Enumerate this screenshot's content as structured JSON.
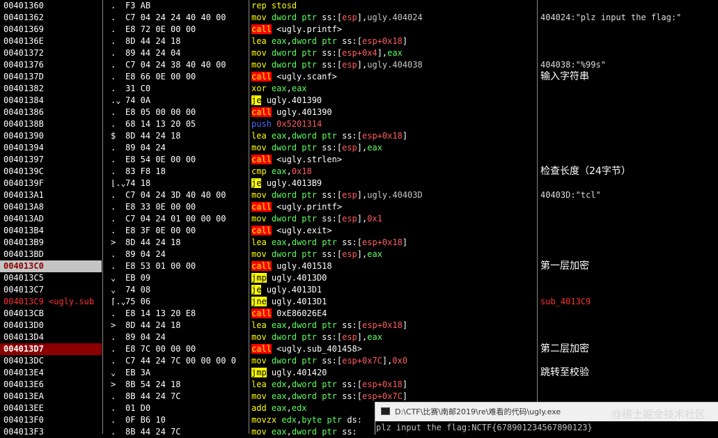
{
  "rows": [
    {
      "addr": "00401360",
      "mark": ".",
      "bytes": "F3 AB",
      "mn": "rep",
      "mt": "plain",
      "ops": [
        {
          "t": "stosd",
          "c": "mnc"
        }
      ],
      "comment": ""
    },
    {
      "addr": "00401362",
      "mark": ".",
      "bytes": "C7 04 24 24 40 40 00",
      "mn": "mov",
      "mt": "plain",
      "ops": [
        {
          "t": "dword ptr ",
          "c": "kw"
        },
        {
          "t": "ss:",
          "c": ""
        },
        {
          "t": "[",
          "c": ""
        },
        {
          "t": "esp",
          "c": "num"
        },
        {
          "t": "]",
          "c": ""
        },
        {
          "t": ",",
          "c": ""
        },
        {
          "t": "ugly.404024",
          "c": "sym"
        }
      ],
      "comment": "404024:\"plz input the flag:\""
    },
    {
      "addr": "00401369",
      "mark": ".",
      "bytes": "E8 72 0E 00 00",
      "mn": "call",
      "mt": "call",
      "ops": [
        {
          "t": "<ugly.printf>",
          "c": ""
        }
      ],
      "comment": ""
    },
    {
      "addr": "0040136E",
      "mark": ".",
      "bytes": "8D 44 24 18",
      "mn": "lea",
      "mt": "plain",
      "ops": [
        {
          "t": "eax",
          "c": "reg"
        },
        {
          "t": ",",
          "c": ""
        },
        {
          "t": "dword ptr ",
          "c": "kw"
        },
        {
          "t": "ss:",
          "c": ""
        },
        {
          "t": "[",
          "c": ""
        },
        {
          "t": "esp",
          "c": "num"
        },
        {
          "t": "+0x18",
          "c": "num"
        },
        {
          "t": "]",
          "c": ""
        }
      ],
      "comment": ""
    },
    {
      "addr": "00401372",
      "mark": ".",
      "bytes": "89 44 24 04",
      "mn": "mov",
      "mt": "plain",
      "ops": [
        {
          "t": "dword ptr ",
          "c": "kw"
        },
        {
          "t": "ss:",
          "c": ""
        },
        {
          "t": "[",
          "c": ""
        },
        {
          "t": "esp",
          "c": "num"
        },
        {
          "t": "+0x4",
          "c": "num"
        },
        {
          "t": "]",
          "c": ""
        },
        {
          "t": ",",
          "c": ""
        },
        {
          "t": "eax",
          "c": "reg"
        }
      ],
      "comment": ""
    },
    {
      "addr": "00401376",
      "mark": ".",
      "bytes": "C7 04 24 38 40 40 00",
      "mn": "mov",
      "mt": "plain",
      "ops": [
        {
          "t": "dword ptr ",
          "c": "kw"
        },
        {
          "t": "ss:",
          "c": ""
        },
        {
          "t": "[",
          "c": ""
        },
        {
          "t": "esp",
          "c": "num"
        },
        {
          "t": "]",
          "c": ""
        },
        {
          "t": ",",
          "c": ""
        },
        {
          "t": "ugly.404038",
          "c": "sym"
        }
      ],
      "comment": "404038:\"%99s\""
    },
    {
      "addr": "0040137D",
      "mark": ".",
      "bytes": "E8 66 0E 00 00",
      "mn": "call",
      "mt": "call",
      "ops": [
        {
          "t": "<ugly.scanf>",
          "c": ""
        }
      ],
      "comment": "输入字符串",
      "ccls": "cjk"
    },
    {
      "addr": "00401382",
      "mark": ".",
      "bytes": "31 C0",
      "mn": "xor",
      "mt": "plain",
      "ops": [
        {
          "t": "eax",
          "c": "reg"
        },
        {
          "t": ",",
          "c": ""
        },
        {
          "t": "eax",
          "c": "reg"
        }
      ],
      "comment": ""
    },
    {
      "addr": "00401384",
      "mark": ".⌄",
      "bytes": "74 0A",
      "mn": "je",
      "mt": "jcc",
      "ops": [
        {
          "t": "ugly.401390",
          "c": ""
        }
      ],
      "comment": ""
    },
    {
      "addr": "00401386",
      "mark": ".",
      "bytes": "E8 05 00 00 00",
      "mn": "call",
      "mt": "call",
      "ops": [
        {
          "t": "ugly.401390",
          "c": ""
        }
      ],
      "comment": ""
    },
    {
      "addr": "0040138B",
      "mark": ".",
      "bytes": "68 14 13 20 05",
      "mn": "push",
      "mt": "push",
      "ops": [
        {
          "t": "0x5201314",
          "c": "num"
        }
      ],
      "comment": ""
    },
    {
      "addr": "00401390",
      "mark": "$",
      "bytes": "8D 44 24 18",
      "mn": "lea",
      "mt": "plain",
      "ops": [
        {
          "t": "eax",
          "c": "reg"
        },
        {
          "t": ",",
          "c": ""
        },
        {
          "t": "dword ptr ",
          "c": "kw"
        },
        {
          "t": "ss:",
          "c": ""
        },
        {
          "t": "[",
          "c": ""
        },
        {
          "t": "esp",
          "c": "num"
        },
        {
          "t": "+0x18",
          "c": "num"
        },
        {
          "t": "]",
          "c": ""
        }
      ],
      "comment": ""
    },
    {
      "addr": "00401394",
      "mark": ".",
      "bytes": "89 04 24",
      "mn": "mov",
      "mt": "plain",
      "ops": [
        {
          "t": "dword ptr ",
          "c": "kw"
        },
        {
          "t": "ss:",
          "c": ""
        },
        {
          "t": "[",
          "c": ""
        },
        {
          "t": "esp",
          "c": "num"
        },
        {
          "t": "]",
          "c": ""
        },
        {
          "t": ",",
          "c": ""
        },
        {
          "t": "eax",
          "c": "reg"
        }
      ],
      "comment": ""
    },
    {
      "addr": "00401397",
      "mark": ".",
      "bytes": "E8 54 0E 00 00",
      "mn": "call",
      "mt": "call",
      "ops": [
        {
          "t": "<ugly.strlen>",
          "c": ""
        }
      ],
      "comment": ""
    },
    {
      "addr": "0040139C",
      "mark": ".",
      "bytes": "83 F8 18",
      "mn": "cmp",
      "mt": "plain",
      "ops": [
        {
          "t": "eax",
          "c": "reg"
        },
        {
          "t": ",",
          "c": ""
        },
        {
          "t": "0x18",
          "c": "num"
        }
      ],
      "comment": "检查长度（24字节）",
      "ccls": "cjk"
    },
    {
      "addr": "0040139F",
      "mark": "⌊.⌄",
      "bytes": "74 18",
      "mn": "je",
      "mt": "jcc",
      "ops": [
        {
          "t": "ugly.4013B9",
          "c": ""
        }
      ],
      "comment": ""
    },
    {
      "addr": "004013A1",
      "mark": ".",
      "bytes": "C7 04 24 3D 40 40 00",
      "mn": "mov",
      "mt": "plain",
      "ops": [
        {
          "t": "dword ptr ",
          "c": "kw"
        },
        {
          "t": "ss:",
          "c": ""
        },
        {
          "t": "[",
          "c": ""
        },
        {
          "t": "esp",
          "c": "num"
        },
        {
          "t": "]",
          "c": ""
        },
        {
          "t": ",",
          "c": ""
        },
        {
          "t": "ugly.40403D",
          "c": "sym"
        }
      ],
      "comment": "40403D:\"tcl\""
    },
    {
      "addr": "004013A8",
      "mark": ".",
      "bytes": "E8 33 0E 00 00",
      "mn": "call",
      "mt": "call",
      "ops": [
        {
          "t": "<ugly.printf>",
          "c": ""
        }
      ],
      "comment": ""
    },
    {
      "addr": "004013AD",
      "mark": ".",
      "bytes": "C7 04 24 01 00 00 00",
      "mn": "mov",
      "mt": "plain",
      "ops": [
        {
          "t": "dword ptr ",
          "c": "kw"
        },
        {
          "t": "ss:",
          "c": ""
        },
        {
          "t": "[",
          "c": ""
        },
        {
          "t": "esp",
          "c": "num"
        },
        {
          "t": "]",
          "c": ""
        },
        {
          "t": ",",
          "c": ""
        },
        {
          "t": "0x1",
          "c": "num"
        }
      ],
      "comment": ""
    },
    {
      "addr": "004013B4",
      "mark": ".",
      "bytes": "E8 3F 0E 00 00",
      "mn": "call",
      "mt": "call",
      "ops": [
        {
          "t": "<ugly.exit>",
          "c": ""
        }
      ],
      "comment": ""
    },
    {
      "addr": "004013B9",
      "mark": ">",
      "bytes": "8D 44 24 18",
      "mn": "lea",
      "mt": "plain",
      "ops": [
        {
          "t": "eax",
          "c": "reg"
        },
        {
          "t": ",",
          "c": ""
        },
        {
          "t": "dword ptr ",
          "c": "kw"
        },
        {
          "t": "ss:",
          "c": ""
        },
        {
          "t": "[",
          "c": ""
        },
        {
          "t": "esp",
          "c": "num"
        },
        {
          "t": "+0x18",
          "c": "num"
        },
        {
          "t": "]",
          "c": ""
        }
      ],
      "comment": ""
    },
    {
      "addr": "004013BD",
      "mark": ".",
      "bytes": "89 04 24",
      "mn": "mov",
      "mt": "plain",
      "ops": [
        {
          "t": "dword ptr ",
          "c": "kw"
        },
        {
          "t": "ss:",
          "c": ""
        },
        {
          "t": "[",
          "c": ""
        },
        {
          "t": "esp",
          "c": "num"
        },
        {
          "t": "]",
          "c": ""
        },
        {
          "t": ",",
          "c": ""
        },
        {
          "t": "eax",
          "c": "reg"
        }
      ],
      "comment": ""
    },
    {
      "addr": "004013C0",
      "mark": ".",
      "bytes": "E8 53 01 00 00",
      "mn": "call",
      "mt": "call",
      "ops": [
        {
          "t": "ugly.401518",
          "c": ""
        }
      ],
      "comment": "第一层加密",
      "ccls": "cjk",
      "hl": "grey"
    },
    {
      "addr": "004013C5",
      "mark": "⌄",
      "bytes": "EB 09",
      "mn": "jmp",
      "mt": "jmp",
      "ops": [
        {
          "t": "ugly.4013D0",
          "c": ""
        }
      ],
      "comment": ""
    },
    {
      "addr": "004013C7",
      "mark": "⌄",
      "bytes": "74 08",
      "mn": "je",
      "mt": "jcc",
      "ops": [
        {
          "t": "ugly.4013D1",
          "c": ""
        }
      ],
      "comment": ""
    },
    {
      "addr": "004013C9 <ugly.sub",
      "mark": "⌈.⌄",
      "bytes": "75 06",
      "mn": "jne",
      "mt": "jcc",
      "ops": [
        {
          "t": "ugly.4013D1",
          "c": ""
        }
      ],
      "comment": "sub_4013C9",
      "ccls": "red",
      "hl": "redtext"
    },
    {
      "addr": "004013CB",
      "mark": ".",
      "bytes": "E8 14 13 20 E8",
      "mn": "call",
      "mt": "call",
      "ops": [
        {
          "t": "0xE86026E4",
          "c": ""
        }
      ],
      "comment": ""
    },
    {
      "addr": "004013D0",
      "mark": ">",
      "bytes": "8D 44 24 18",
      "mn": "lea",
      "mt": "plain",
      "ops": [
        {
          "t": "eax",
          "c": "reg"
        },
        {
          "t": ",",
          "c": ""
        },
        {
          "t": "dword ptr ",
          "c": "kw"
        },
        {
          "t": "ss:",
          "c": ""
        },
        {
          "t": "[",
          "c": ""
        },
        {
          "t": "esp",
          "c": "num"
        },
        {
          "t": "+0x18",
          "c": "num"
        },
        {
          "t": "]",
          "c": ""
        }
      ],
      "comment": ""
    },
    {
      "addr": "004013D4",
      "mark": ".",
      "bytes": "89 04 24",
      "mn": "mov",
      "mt": "plain",
      "ops": [
        {
          "t": "dword ptr ",
          "c": "kw"
        },
        {
          "t": "ss:",
          "c": ""
        },
        {
          "t": "[",
          "c": ""
        },
        {
          "t": "esp",
          "c": "num"
        },
        {
          "t": "]",
          "c": ""
        },
        {
          "t": ",",
          "c": ""
        },
        {
          "t": "eax",
          "c": "reg"
        }
      ],
      "comment": ""
    },
    {
      "addr": "004013D7",
      "mark": ".",
      "bytes": "E8 7C 00 00 00",
      "mn": "call",
      "mt": "call",
      "ops": [
        {
          "t": "<ugly.sub_401458>",
          "c": ""
        }
      ],
      "comment": "第二层加密",
      "ccls": "cjk",
      "hl": "red"
    },
    {
      "addr": "004013DC",
      "mark": ".",
      "bytes": "C7 44 24 7C 00 00 00 0",
      "mn": "mov",
      "mt": "plain",
      "ops": [
        {
          "t": "dword ptr ",
          "c": "kw"
        },
        {
          "t": "ss:",
          "c": ""
        },
        {
          "t": "[",
          "c": ""
        },
        {
          "t": "esp",
          "c": "num"
        },
        {
          "t": "+0x7C",
          "c": "num"
        },
        {
          "t": "]",
          "c": ""
        },
        {
          "t": ",",
          "c": ""
        },
        {
          "t": "0x0",
          "c": "num"
        }
      ],
      "comment": ""
    },
    {
      "addr": "004013E4",
      "mark": "⌄",
      "bytes": "EB 3A",
      "mn": "jmp",
      "mt": "jmp",
      "ops": [
        {
          "t": "ugly.401420",
          "c": ""
        }
      ],
      "comment": "跳转至校验",
      "ccls": "cjk"
    },
    {
      "addr": "004013E6",
      "mark": ">",
      "bytes": "8B 54 24 18",
      "mn": "lea",
      "mt": "plain",
      "ops": [
        {
          "t": "edx",
          "c": "reg"
        },
        {
          "t": ",",
          "c": ""
        },
        {
          "t": "dword ptr ",
          "c": "kw"
        },
        {
          "t": "ss:",
          "c": ""
        },
        {
          "t": "[",
          "c": ""
        },
        {
          "t": "esp",
          "c": "num"
        },
        {
          "t": "+0x18",
          "c": "num"
        },
        {
          "t": "]",
          "c": ""
        }
      ],
      "comment": ""
    },
    {
      "addr": "004013EA",
      "mark": ".",
      "bytes": "8B 44 24 7C",
      "mn": "mov",
      "mt": "plain",
      "ops": [
        {
          "t": "eax",
          "c": "reg"
        },
        {
          "t": ",",
          "c": ""
        },
        {
          "t": "dword ptr ",
          "c": "kw"
        },
        {
          "t": "ss:",
          "c": ""
        },
        {
          "t": "[",
          "c": ""
        },
        {
          "t": "esp",
          "c": "num"
        },
        {
          "t": "+0x7C",
          "c": "num"
        },
        {
          "t": "]",
          "c": ""
        }
      ],
      "comment": ""
    },
    {
      "addr": "004013EE",
      "mark": ".",
      "bytes": "01 D0",
      "mn": "add",
      "mt": "plain",
      "ops": [
        {
          "t": "eax",
          "c": "reg"
        },
        {
          "t": ",",
          "c": ""
        },
        {
          "t": "edx",
          "c": "reg"
        }
      ],
      "comment": ""
    },
    {
      "addr": "004013F0",
      "mark": ".",
      "bytes": "0F B6 10",
      "mn": "movzx",
      "mt": "plain",
      "ops": [
        {
          "t": "edx",
          "c": "reg"
        },
        {
          "t": ",",
          "c": ""
        },
        {
          "t": "byte ptr ",
          "c": "kw"
        },
        {
          "t": "ds:",
          "c": ""
        }
      ],
      "comment": ""
    },
    {
      "addr": "004013F3",
      "mark": ".",
      "bytes": "8B 44 24 7C",
      "mn": "mov",
      "mt": "plain",
      "ops": [
        {
          "t": "eax",
          "c": "reg"
        },
        {
          "t": ",",
          "c": ""
        },
        {
          "t": "dword ptr ",
          "c": "kw"
        },
        {
          "t": "ss:",
          "c": ""
        }
      ],
      "comment": ""
    }
  ],
  "console": {
    "title": "D:\\CTF\\比赛\\南邮2019\\re\\难看的代码\\ugly.exe",
    "output": "plz input the flag:NCTF{678901234567890123}"
  },
  "watermark": "@稀土掘金技术社区"
}
